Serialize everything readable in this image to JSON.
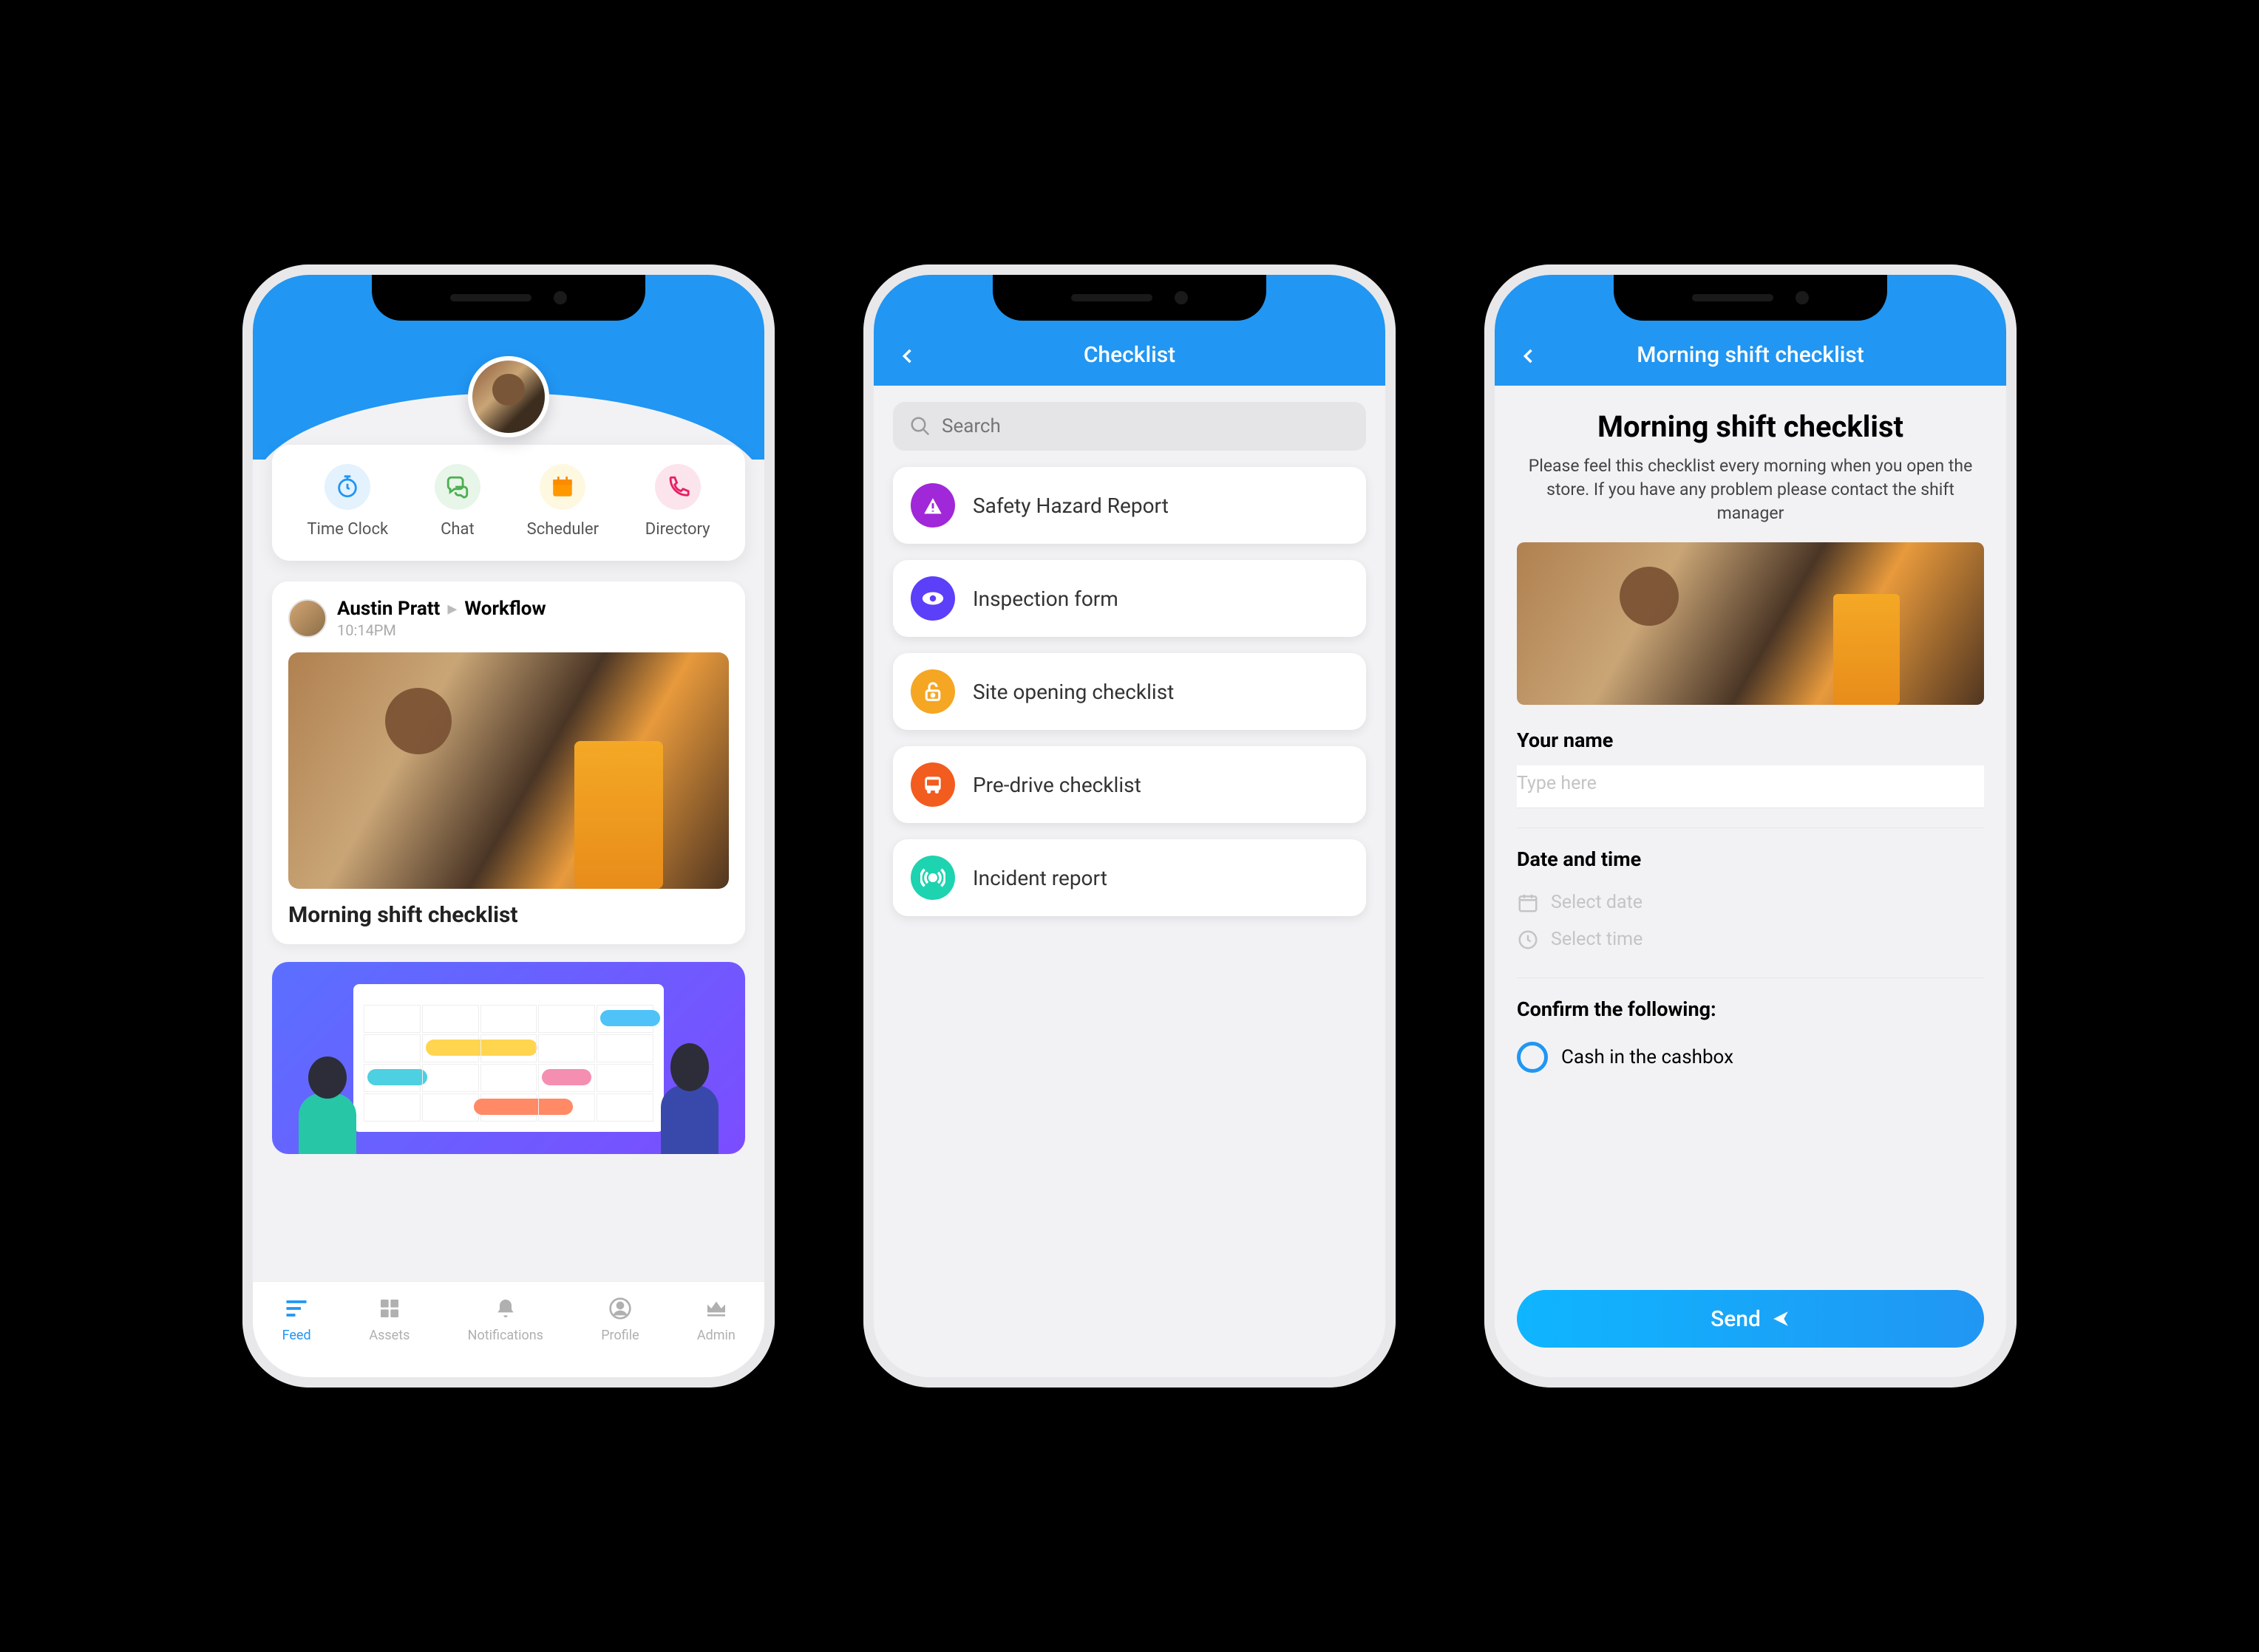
{
  "feed": {
    "quick": [
      {
        "label": "Time Clock"
      },
      {
        "label": "Chat"
      },
      {
        "label": "Scheduler"
      },
      {
        "label": "Directory"
      }
    ],
    "post": {
      "author": "Austin Pratt",
      "target": "Workflow",
      "time": "10:14PM",
      "title": "Morning shift checklist"
    },
    "tabs": [
      {
        "label": "Feed"
      },
      {
        "label": "Assets"
      },
      {
        "label": "Notifications"
      },
      {
        "label": "Profile"
      },
      {
        "label": "Admin"
      }
    ]
  },
  "checklist": {
    "title": "Checklist",
    "search_placeholder": "Search",
    "items": [
      {
        "label": "Safety Hazard Report"
      },
      {
        "label": "Inspection form"
      },
      {
        "label": "Site opening checklist"
      },
      {
        "label": "Pre-drive checklist"
      },
      {
        "label": "Incident report"
      }
    ]
  },
  "form": {
    "header": "Morning shift checklist",
    "title": "Morning shift checklist",
    "subtitle": "Please feel this checklist every morning when you open the store. If you have any problem please contact the shift manager",
    "name_label": "Your name",
    "name_placeholder": "Type here",
    "datetime_label": "Date and time",
    "date_placeholder": "Select date",
    "time_placeholder": "Select time",
    "confirm_label": "Confirm the following:",
    "option1": "Cash in the cashbox",
    "send": "Send"
  }
}
